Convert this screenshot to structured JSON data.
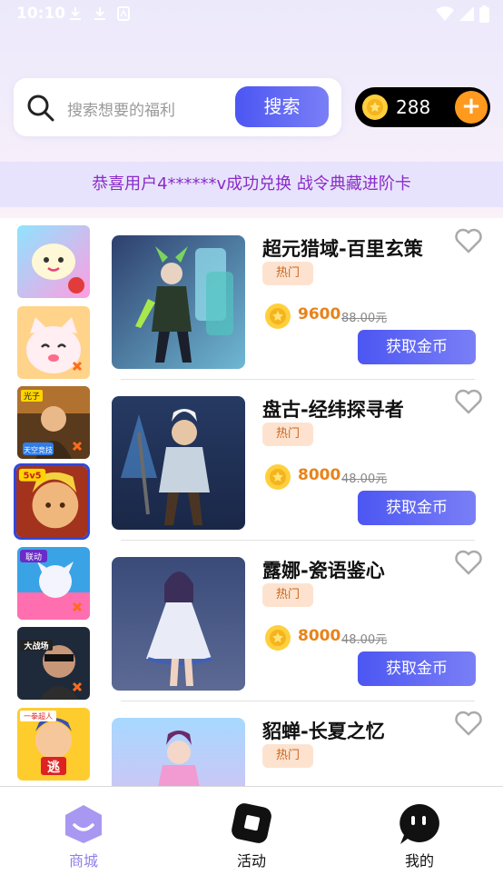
{
  "status_bar": {
    "time": "10:10"
  },
  "search": {
    "placeholder": "搜索想要的福利",
    "button_label": "搜索"
  },
  "coins": {
    "balance": "288",
    "add_label": "+"
  },
  "notice": {
    "text": "恭喜用户4******v成功兑换 战令典藏进阶卡"
  },
  "sidebar": {
    "items": [
      {
        "name": "game-1",
        "active": false
      },
      {
        "name": "game-2",
        "active": false
      },
      {
        "name": "game-3",
        "active": false,
        "badge": "光子",
        "subtext": "天空竞技"
      },
      {
        "name": "game-4",
        "active": true,
        "badge": "5v5"
      },
      {
        "name": "game-5",
        "active": false,
        "badge": "联动"
      },
      {
        "name": "game-6",
        "active": false,
        "badge": "大战场"
      },
      {
        "name": "game-7",
        "active": false,
        "badge": "一拳超人",
        "subtext": "逃"
      }
    ]
  },
  "products": [
    {
      "title": "超元猎域-百里玄策",
      "tag": "热门",
      "price": "9600",
      "original": "88.00元",
      "button": "获取金币"
    },
    {
      "title": "盘古-经纬探寻者",
      "tag": "热门",
      "price": "8000",
      "original": "48.00元",
      "button": "获取金币"
    },
    {
      "title": "露娜-瓷语鉴心",
      "tag": "热门",
      "price": "8000",
      "original": "48.00元",
      "button": "获取金币"
    },
    {
      "title": "貂蝉-长夏之忆",
      "tag": "热门"
    }
  ],
  "bottom_nav": {
    "items": [
      {
        "label": "商城",
        "active": true
      },
      {
        "label": "活动",
        "active": false
      },
      {
        "label": "我的",
        "active": false
      }
    ]
  },
  "colors": {
    "accent": "#5b5ff4",
    "price": "#e8831a",
    "notice_text": "#8a2cc7",
    "active_nav": "#8f7fe8"
  }
}
